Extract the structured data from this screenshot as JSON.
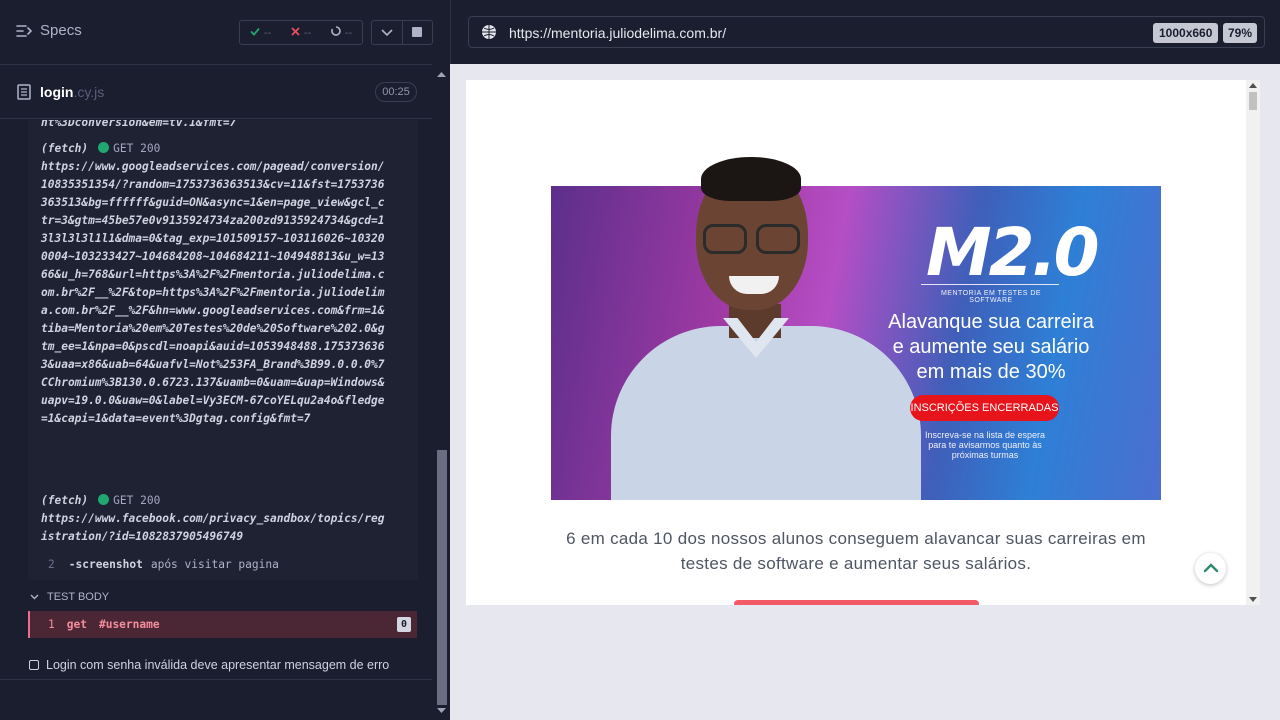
{
  "reporter": {
    "specs_label": "Specs",
    "stats": {
      "passed": "--",
      "failed": "--",
      "pending": "--"
    },
    "spec": {
      "name": "login",
      "ext": ".cy.js",
      "duration": "00:25"
    },
    "log": {
      "top_fragment": "nt%3Dconversion&em=tv.1&fmt=7",
      "entries": [
        {
          "type": "(fetch)",
          "method": "GET 200",
          "url": "https://www.googleadservices.com/pagead/conversion/10835351354/?random=1753736363513&cv=11&fst=1753736363513&bg=ffffff&guid=ON&async=1&en=page_view&gcl_ctr=3&gtm=45be57e0v9135924734za200zd9135924734&gcd=13l3l3l3l1l1&dma=0&tag_exp=101509157~103116026~103200004~103233427~104684208~104684211~104948813&u_w=1366&u_h=768&url=https%3A%2F%2Fmentoria.juliodelima.com.br%2F__%2F&top=https%3A%2F%2Fmentoria.juliodelima.com.br%2F__%2F&hn=www.googleadservices.com&frm=1&tiba=Mentoria%20em%20Testes%20de%20Software%202.0&gtm_ee=1&npa=0&pscdl=noapi&auid=1053948488.1753736363&uaa=x86&uab=64&uafvl=Not%253FA_Brand%3B99.0.0.0%7CChromium%3B130.0.6723.137&uamb=0&uam=&uap=Windows&uapv=19.0.0&uaw=0&label=Vy3ECM-67coYELqu2a4o&fledge=1&capi=1&data=event%3Dgtag.config&fmt=7"
        },
        {
          "type": "(fetch)",
          "method": "GET 200",
          "url": "https://www.facebook.com/privacy_sandbox/topics/registration/?id=1082837905496749"
        }
      ],
      "commands": [
        {
          "num": "2",
          "name": "-screenshot",
          "arg": "após visitar pagina"
        }
      ]
    },
    "test_body_label": "TEST BODY",
    "test_body_commands": [
      {
        "num": "1",
        "name": "get",
        "arg": "#username",
        "badge": "0"
      }
    ],
    "pending_test": "Login com senha inválida deve apresentar mensagem de erro"
  },
  "aut": {
    "url": "https://mentoria.juliodelima.com.br/",
    "viewport": "1000x660",
    "zoom": "79%",
    "page": {
      "banner": {
        "logo": "M2.0",
        "subtitle": "MENTORIA EM TESTES DE SOFTWARE",
        "headline_lines": [
          "Alavanque sua carreira",
          "e aumente seu salário",
          "em mais de 30%"
        ],
        "button": "INSCRIÇÕES ENCERRADAS",
        "note_lines": [
          "Inscreva-se na lista de espera",
          "para te avisarmos quanto às",
          "próximas turmas"
        ]
      },
      "stats_text_lines": [
        "6 em cada 10 dos nossos alunos conseguem alavancar suas carreiras em",
        "testes de software e aumentar seus salários."
      ]
    }
  },
  "colors": {
    "reporter_bg": "#1b1e2e",
    "passed": "#1fa971",
    "failed": "#e94f5f",
    "active_command_bg": "#4b2736",
    "active_command_text": "#f68c9c",
    "banner_button": "#e8141b"
  },
  "icons": [
    "specs-list-icon",
    "check-icon",
    "x-icon",
    "spinner-icon",
    "chevron-down-icon",
    "stop-icon",
    "file-icon",
    "globe-icon",
    "chevron-up-icon",
    "checkbox-icon"
  ]
}
